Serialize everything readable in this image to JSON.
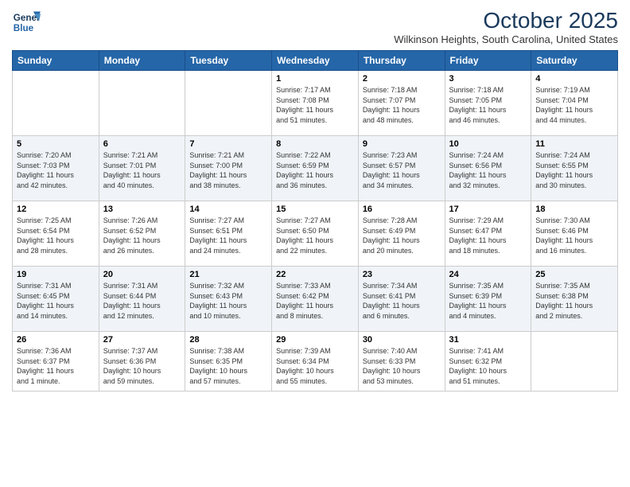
{
  "logo": {
    "line1": "General",
    "line2": "Blue"
  },
  "title": "October 2025",
  "subtitle": "Wilkinson Heights, South Carolina, United States",
  "days_header": [
    "Sunday",
    "Monday",
    "Tuesday",
    "Wednesday",
    "Thursday",
    "Friday",
    "Saturday"
  ],
  "weeks": [
    [
      {
        "num": "",
        "info": ""
      },
      {
        "num": "",
        "info": ""
      },
      {
        "num": "",
        "info": ""
      },
      {
        "num": "1",
        "info": "Sunrise: 7:17 AM\nSunset: 7:08 PM\nDaylight: 11 hours\nand 51 minutes."
      },
      {
        "num": "2",
        "info": "Sunrise: 7:18 AM\nSunset: 7:07 PM\nDaylight: 11 hours\nand 48 minutes."
      },
      {
        "num": "3",
        "info": "Sunrise: 7:18 AM\nSunset: 7:05 PM\nDaylight: 11 hours\nand 46 minutes."
      },
      {
        "num": "4",
        "info": "Sunrise: 7:19 AM\nSunset: 7:04 PM\nDaylight: 11 hours\nand 44 minutes."
      }
    ],
    [
      {
        "num": "5",
        "info": "Sunrise: 7:20 AM\nSunset: 7:03 PM\nDaylight: 11 hours\nand 42 minutes."
      },
      {
        "num": "6",
        "info": "Sunrise: 7:21 AM\nSunset: 7:01 PM\nDaylight: 11 hours\nand 40 minutes."
      },
      {
        "num": "7",
        "info": "Sunrise: 7:21 AM\nSunset: 7:00 PM\nDaylight: 11 hours\nand 38 minutes."
      },
      {
        "num": "8",
        "info": "Sunrise: 7:22 AM\nSunset: 6:59 PM\nDaylight: 11 hours\nand 36 minutes."
      },
      {
        "num": "9",
        "info": "Sunrise: 7:23 AM\nSunset: 6:57 PM\nDaylight: 11 hours\nand 34 minutes."
      },
      {
        "num": "10",
        "info": "Sunrise: 7:24 AM\nSunset: 6:56 PM\nDaylight: 11 hours\nand 32 minutes."
      },
      {
        "num": "11",
        "info": "Sunrise: 7:24 AM\nSunset: 6:55 PM\nDaylight: 11 hours\nand 30 minutes."
      }
    ],
    [
      {
        "num": "12",
        "info": "Sunrise: 7:25 AM\nSunset: 6:54 PM\nDaylight: 11 hours\nand 28 minutes."
      },
      {
        "num": "13",
        "info": "Sunrise: 7:26 AM\nSunset: 6:52 PM\nDaylight: 11 hours\nand 26 minutes."
      },
      {
        "num": "14",
        "info": "Sunrise: 7:27 AM\nSunset: 6:51 PM\nDaylight: 11 hours\nand 24 minutes."
      },
      {
        "num": "15",
        "info": "Sunrise: 7:27 AM\nSunset: 6:50 PM\nDaylight: 11 hours\nand 22 minutes."
      },
      {
        "num": "16",
        "info": "Sunrise: 7:28 AM\nSunset: 6:49 PM\nDaylight: 11 hours\nand 20 minutes."
      },
      {
        "num": "17",
        "info": "Sunrise: 7:29 AM\nSunset: 6:47 PM\nDaylight: 11 hours\nand 18 minutes."
      },
      {
        "num": "18",
        "info": "Sunrise: 7:30 AM\nSunset: 6:46 PM\nDaylight: 11 hours\nand 16 minutes."
      }
    ],
    [
      {
        "num": "19",
        "info": "Sunrise: 7:31 AM\nSunset: 6:45 PM\nDaylight: 11 hours\nand 14 minutes."
      },
      {
        "num": "20",
        "info": "Sunrise: 7:31 AM\nSunset: 6:44 PM\nDaylight: 11 hours\nand 12 minutes."
      },
      {
        "num": "21",
        "info": "Sunrise: 7:32 AM\nSunset: 6:43 PM\nDaylight: 11 hours\nand 10 minutes."
      },
      {
        "num": "22",
        "info": "Sunrise: 7:33 AM\nSunset: 6:42 PM\nDaylight: 11 hours\nand 8 minutes."
      },
      {
        "num": "23",
        "info": "Sunrise: 7:34 AM\nSunset: 6:41 PM\nDaylight: 11 hours\nand 6 minutes."
      },
      {
        "num": "24",
        "info": "Sunrise: 7:35 AM\nSunset: 6:39 PM\nDaylight: 11 hours\nand 4 minutes."
      },
      {
        "num": "25",
        "info": "Sunrise: 7:35 AM\nSunset: 6:38 PM\nDaylight: 11 hours\nand 2 minutes."
      }
    ],
    [
      {
        "num": "26",
        "info": "Sunrise: 7:36 AM\nSunset: 6:37 PM\nDaylight: 11 hours\nand 1 minute."
      },
      {
        "num": "27",
        "info": "Sunrise: 7:37 AM\nSunset: 6:36 PM\nDaylight: 10 hours\nand 59 minutes."
      },
      {
        "num": "28",
        "info": "Sunrise: 7:38 AM\nSunset: 6:35 PM\nDaylight: 10 hours\nand 57 minutes."
      },
      {
        "num": "29",
        "info": "Sunrise: 7:39 AM\nSunset: 6:34 PM\nDaylight: 10 hours\nand 55 minutes."
      },
      {
        "num": "30",
        "info": "Sunrise: 7:40 AM\nSunset: 6:33 PM\nDaylight: 10 hours\nand 53 minutes."
      },
      {
        "num": "31",
        "info": "Sunrise: 7:41 AM\nSunset: 6:32 PM\nDaylight: 10 hours\nand 51 minutes."
      },
      {
        "num": "",
        "info": ""
      }
    ]
  ]
}
